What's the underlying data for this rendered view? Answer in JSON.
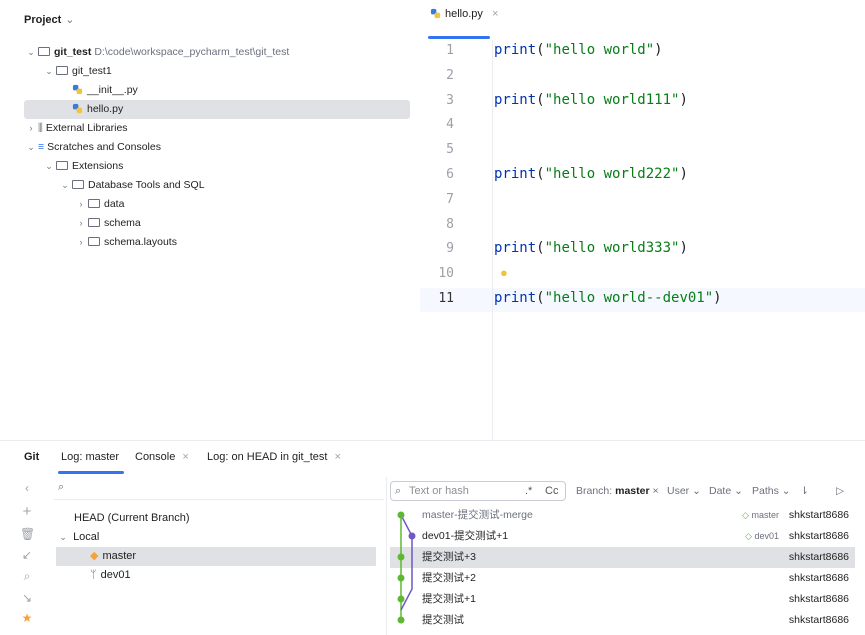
{
  "project": {
    "header": "Project",
    "tree": [
      {
        "label": "git_test",
        "path": "D:\\code\\workspace_pycharm_test\\git_test"
      },
      {
        "label": "git_test1"
      },
      {
        "label": "__init__.py"
      },
      {
        "label": "hello.py"
      },
      {
        "label": "External Libraries"
      },
      {
        "label": "Scratches and Consoles"
      },
      {
        "label": "Extensions"
      },
      {
        "label": "Database Tools and SQL"
      },
      {
        "label": "data"
      },
      {
        "label": "schema"
      },
      {
        "label": "schema.layouts"
      }
    ]
  },
  "editor": {
    "tab_label": "hello.py",
    "lines": [
      {
        "n": "1",
        "fn": "print",
        "arg": "\"hello world\""
      },
      {
        "n": "2"
      },
      {
        "n": "3",
        "fn": "print",
        "arg": "\"hello world111\""
      },
      {
        "n": "4"
      },
      {
        "n": "5"
      },
      {
        "n": "6",
        "fn": "print",
        "arg": "\"hello world222\""
      },
      {
        "n": "7"
      },
      {
        "n": "8"
      },
      {
        "n": "9",
        "fn": "print",
        "arg": "\"hello world333\""
      },
      {
        "n": "10"
      },
      {
        "n": "11",
        "fn": "print",
        "arg": "\"hello world--dev01\""
      }
    ]
  },
  "git": {
    "title": "Git",
    "tabs": [
      "Log: master",
      "Console",
      "Log: on HEAD in git_test"
    ],
    "branches": {
      "head": "HEAD (Current Branch)",
      "local": "Local",
      "items": [
        "master",
        "dev01"
      ]
    },
    "log": {
      "search_placeholder": "Text or hash",
      "regex": ".*",
      "case": "Cc",
      "branch_label": "Branch:",
      "branch_value": "master",
      "filters": [
        "User",
        "Date",
        "Paths"
      ],
      "commits": [
        {
          "msg": "master-提交测试-merge",
          "tag": "master",
          "author": "shkstart8686"
        },
        {
          "msg": "dev01-提交测试+1",
          "tag": "dev01",
          "author": "shkstart8686"
        },
        {
          "msg": "提交测试+3",
          "tag": "",
          "author": "shkstart8686"
        },
        {
          "msg": "提交测试+2",
          "tag": "",
          "author": "shkstart8686"
        },
        {
          "msg": "提交测试+1",
          "tag": "",
          "author": "shkstart8686"
        },
        {
          "msg": "提交测试",
          "tag": "",
          "author": "shkstart8686"
        }
      ]
    },
    "colors": {
      "accent": "#3574f0",
      "graph_green": "#5fb832",
      "graph_purple": "#6f58c4",
      "tag_orange": "#f2a33a"
    }
  }
}
